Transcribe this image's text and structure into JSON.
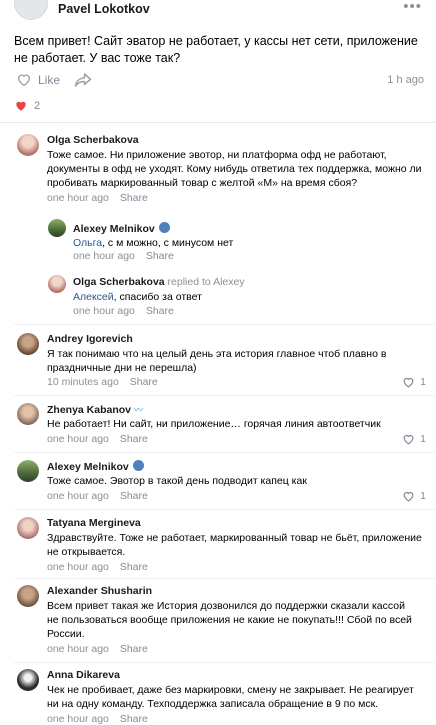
{
  "post": {
    "author": "Pavel Lokotkov",
    "text": "Всем привет! Сайт эватор не работает, у кассы нет сети, приложение не работает. У вас тоже так?",
    "like_label": "Like",
    "time": "1 h ago",
    "likes_count": "2",
    "icons": {
      "like": "heart-outline-icon",
      "share": "share-arrow-icon",
      "more": "more-dots-icon",
      "liked": "heart-filled-icon"
    },
    "colors": {
      "liked": "#e64646",
      "meta": "#818c99",
      "link": "#2a5885"
    }
  },
  "comments": [
    {
      "author": "Olga Scherbakova",
      "text": "Тоже самое. Ни приложение эвотор, ни платформа офд не работают, документы в офд не уходят. Кому нибудь ответила тех поддержка, можно ли пробивать маркированный товар с желтой «М» на время сбоя?",
      "time": "one hour ago",
      "share": "Share"
    },
    {
      "author": "Alexey Melnikov",
      "addressee": "Ольга",
      "text": ", с м можно, с минусом нет",
      "time": "one hour ago",
      "share": "Share"
    },
    {
      "author": "Olga Scherbakova",
      "replied": "replied to Alexey",
      "addressee": "Алексей",
      "text": ", спасибо за ответ",
      "time": "one hour ago",
      "share": "Share"
    },
    {
      "author": "Andrey Igorevich",
      "text": "Я так понимаю что на целый день эта история главное чтоб плавно в праздничные дни не перешла)",
      "time": "10 minutes ago",
      "share": "Share",
      "likes": "1"
    },
    {
      "author": "Zhenya Kabanov",
      "text": "Не работает! Ни сайт, ни приложение… горячая линия автоответчик",
      "time": "one hour ago",
      "share": "Share",
      "likes": "1"
    },
    {
      "author": "Alexey Melnikov",
      "text": "Тоже самое. Эвотор в такой день подводит капец как",
      "time": "one hour ago",
      "share": "Share",
      "likes": "1"
    },
    {
      "author": "Tatyana Mergineva",
      "text": "Здравствуйте. Тоже не работает, маркированный товар не бьёт, приложение не открывается.",
      "time": "one hour ago",
      "share": "Share"
    },
    {
      "author": "Alexander Shusharin",
      "text": "Всем привет такая же История дозвонился до поддержки сказали кассой не пользоваться вообще приложения не какие не покупать!!! Сбой по всей России.",
      "time": "one hour ago",
      "share": "Share"
    },
    {
      "author": "Anna Dikareva",
      "text": "Чек не пробивает, даже без маркировки, смену не закрывает. Не реагирует ни на одну команду. Техподдержка записала обращение в 9 по мск.",
      "time": "one hour ago",
      "share": "Share"
    }
  ]
}
